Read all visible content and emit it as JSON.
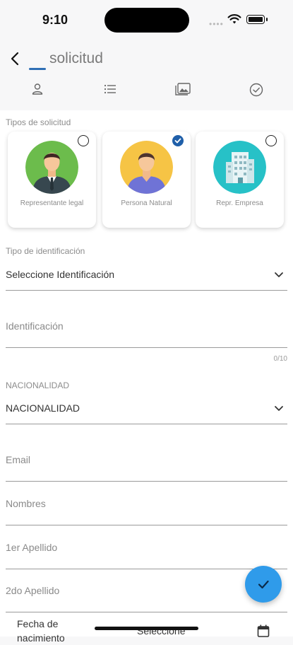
{
  "status_bar": {
    "time": "9:10",
    "signal": "••••"
  },
  "header": {
    "title": "solicitud"
  },
  "tabs": [
    {
      "icon": "person-icon"
    },
    {
      "icon": "list-icon"
    },
    {
      "icon": "gallery-icon"
    },
    {
      "icon": "check-circle-icon"
    }
  ],
  "form": {
    "section_label": "Tipos de solicitud",
    "cards": [
      {
        "label": "Representante legal",
        "selected": false
      },
      {
        "label": "Persona Natural",
        "selected": true
      },
      {
        "label": "Repr.  Empresa",
        "selected": false
      }
    ],
    "id_type": {
      "label": "Tipo de identificación",
      "value": "Seleccione Identificación"
    },
    "identification": {
      "placeholder": "Identificación",
      "counter": "0/10"
    },
    "nationality": {
      "label": "NACIONALIDAD",
      "value": "NACIONALIDAD"
    },
    "email": {
      "placeholder": "Email"
    },
    "names": {
      "placeholder": "Nombres"
    },
    "surname1": {
      "placeholder": "1er Apellido"
    },
    "surname2": {
      "placeholder": "2do Apellido"
    },
    "birth_date": {
      "label": "Fecha de nacimiento",
      "value": "Seleccione"
    }
  },
  "colors": {
    "accent": "#1f5fa9",
    "fab": "#2f9bea"
  }
}
